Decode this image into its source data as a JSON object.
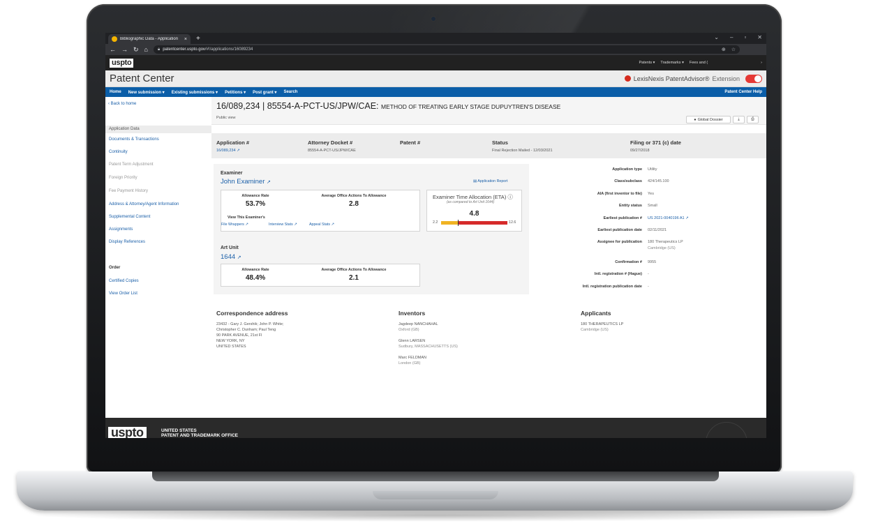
{
  "browser": {
    "tab_title": "Bibliographic Data - Application",
    "tab_close": "×",
    "new_tab": "+",
    "url_host": "patentcenter.uspto.gov",
    "url_path": "/#!/applications/16089234"
  },
  "header": {
    "logo": "uspto",
    "top_nav": [
      "Patents ▾",
      "Trademarks ▾",
      "Fees and ("
    ],
    "site_title": "Patent Center",
    "extension_name": "LexisNexis PatentAdvisor®",
    "extension_label": "Extension"
  },
  "nav": {
    "items": [
      "Home",
      "New submission ▾",
      "Existing submissions ▾",
      "Petitions ▾",
      "Post grant ▾",
      "Search"
    ],
    "help": "Patent Center Help"
  },
  "sidebar": {
    "back": "‹ Back to home",
    "section": "Application Data",
    "items": [
      {
        "label": "Documents & Transactions",
        "enabled": true
      },
      {
        "label": "Continuity",
        "enabled": true
      },
      {
        "label": "Patent Term Adjustment",
        "enabled": false
      },
      {
        "label": "Foreign Priority",
        "enabled": false
      },
      {
        "label": "Fee Payment History",
        "enabled": false
      },
      {
        "label": "Address & Attorney/Agent Information",
        "enabled": true
      },
      {
        "label": "Supplemental Content",
        "enabled": true
      },
      {
        "label": "Assignments",
        "enabled": true
      },
      {
        "label": "Display References",
        "enabled": true
      }
    ],
    "order_title": "Order",
    "order_items": [
      "Certified Copies",
      "View Order List"
    ]
  },
  "application": {
    "title_main": "16/089,234 | 85554-A-PCT-US/JPW/CAE:",
    "title_sub": "METHOD OF TREATING EARLY STAGE DUPUYTREN'S DISEASE",
    "view": "Public view",
    "global_dossier": "Global Dossier",
    "download_icon": "download-icon",
    "print_icon": "print-icon"
  },
  "summary": {
    "app_num_label": "Application #",
    "app_num": "16/089,234",
    "docket_label": "Attorney Docket #",
    "docket": "85554-A-PCT-US/JPW/CAE",
    "patent_label": "Patent #",
    "status_label": "Status",
    "status": "Final Rejection Mailed - 12/03/2021",
    "filing_label": "Filing or 371 (c) date",
    "filing": "09/27/2018"
  },
  "examiner": {
    "section": "Examiner",
    "name": "John Examiner",
    "report": "Application Report",
    "allowance_rate_label": "Allowance Rate",
    "allowance_rate": "53.7%",
    "avg_oa_label": "Average Office Actions To Allowance",
    "avg_oa": "2.8",
    "view_label": "View This Examiner's",
    "links": [
      "File Wrappers",
      "Interview Stats",
      "Appeal Stats"
    ],
    "eta_title": "Examiner Time Allocation (ETA)",
    "eta_note": "(as compared to Art Unit 1644)",
    "eta_value": 4.8,
    "eta_value_text": "4.8",
    "eta_min": 2.2,
    "eta_min_text": "2.2",
    "eta_max": 12.6,
    "eta_max_text": "12.6",
    "colors": {
      "low": "#f0b323",
      "high": "#d62b2b"
    }
  },
  "art_unit": {
    "section": "Art Unit",
    "number": "1644",
    "allowance_rate_label": "Allowance Rate",
    "allowance_rate": "48.4%",
    "avg_oa_label": "Average Office Actions To Allowance",
    "avg_oa": "2.1"
  },
  "details": [
    {
      "k": "Application type",
      "v": "Utility"
    },
    {
      "k": "Class/subclass",
      "v": "424/145.100"
    },
    {
      "k": "AIA (first inventor to file)",
      "v": "Yes"
    },
    {
      "k": "Entity status",
      "v": "Small"
    },
    {
      "k": "Earliest publication #",
      "v": "US 2021-0040196 A1"
    },
    {
      "k": "Earliest publication date",
      "v": "02/11/2021"
    },
    {
      "k": "Assignee for publication",
      "v": "180 Therapeutics LP",
      "v2": "Cambridge (US)"
    },
    {
      "k": "Confirmation #",
      "v": "9955"
    },
    {
      "k": "Intl. registration # (Hague)",
      "v": "-"
    },
    {
      "k": "Intl. registration publication date",
      "v": "-"
    }
  ],
  "correspondence": {
    "title": "Correspondence address",
    "lines": [
      "23432 - Gary J. Gershik; John P. White;",
      "Christopher C. Dunham; Paul Teng",
      "90 PARK AVENUE, 21st Fl",
      "NEW YORK, NY",
      "UNITED STATES"
    ]
  },
  "inventors": {
    "title": "Inventors",
    "people": [
      {
        "name": "Jagdeep NANCHAHAL",
        "loc": "Oxford (GB)"
      },
      {
        "name": "Glenn LARSEN",
        "loc": "Sudbury, MASSACHUSETTS (US)"
      },
      {
        "name": "Marc FELDMAN",
        "loc": "London (GB)"
      }
    ]
  },
  "applicants": {
    "title": "Applicants",
    "name": "180 THERAPEUTICS LP",
    "loc": "Cambridge (US)"
  },
  "footer": {
    "logo": "uspto",
    "line1": "UNITED STATES",
    "line2": "PATENT AND TRADEMARK OFFICE"
  }
}
